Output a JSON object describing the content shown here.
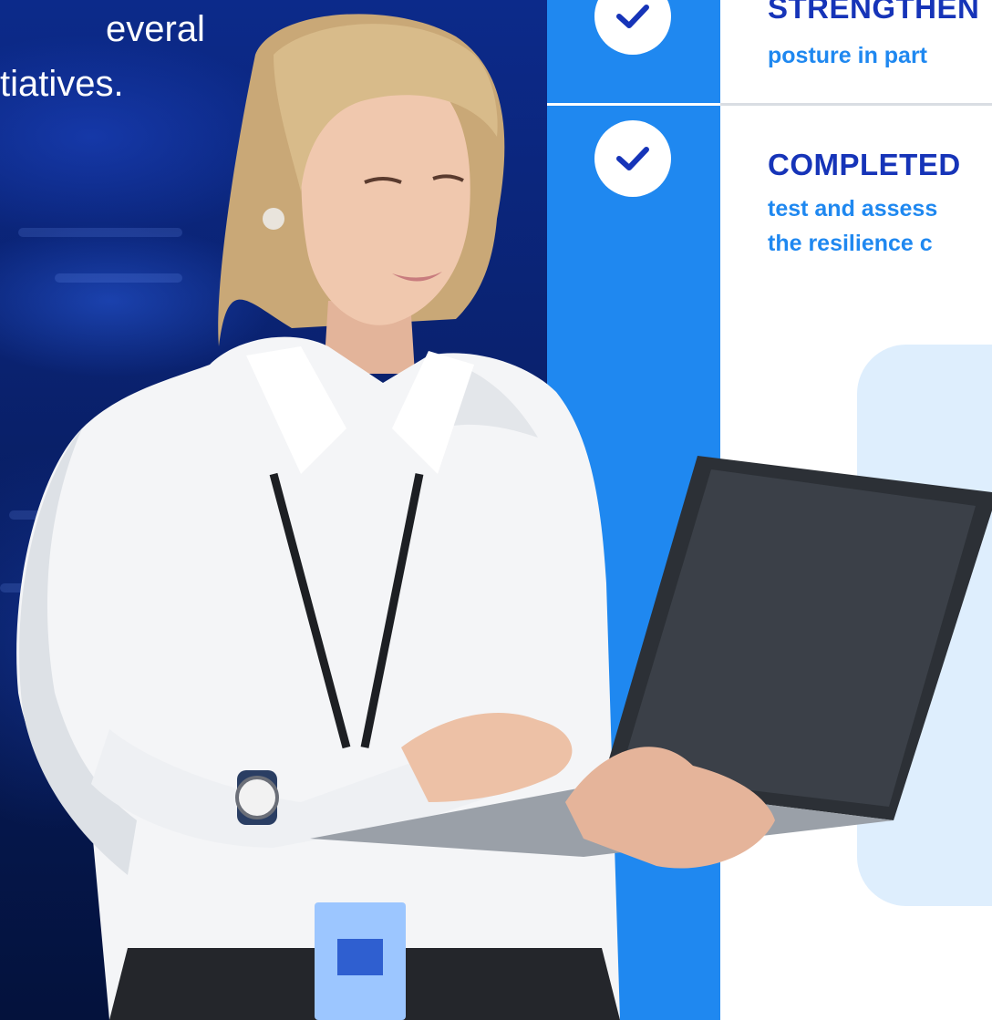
{
  "intro": {
    "line1": "everal",
    "line2": "tiatives."
  },
  "items": [
    {
      "title": "STRENGTHEN",
      "body_lines": [
        "posture in part"
      ]
    },
    {
      "title": "COMPLETED",
      "body_lines": [
        "test and assess",
        "the resilience c"
      ]
    }
  ],
  "icons": {
    "check": "checkmark-icon"
  },
  "colors": {
    "column_blue": "#1f88f0",
    "title_navy": "#1634b8",
    "body_blue": "#1f88f0",
    "card_tint": "#deeefd"
  }
}
